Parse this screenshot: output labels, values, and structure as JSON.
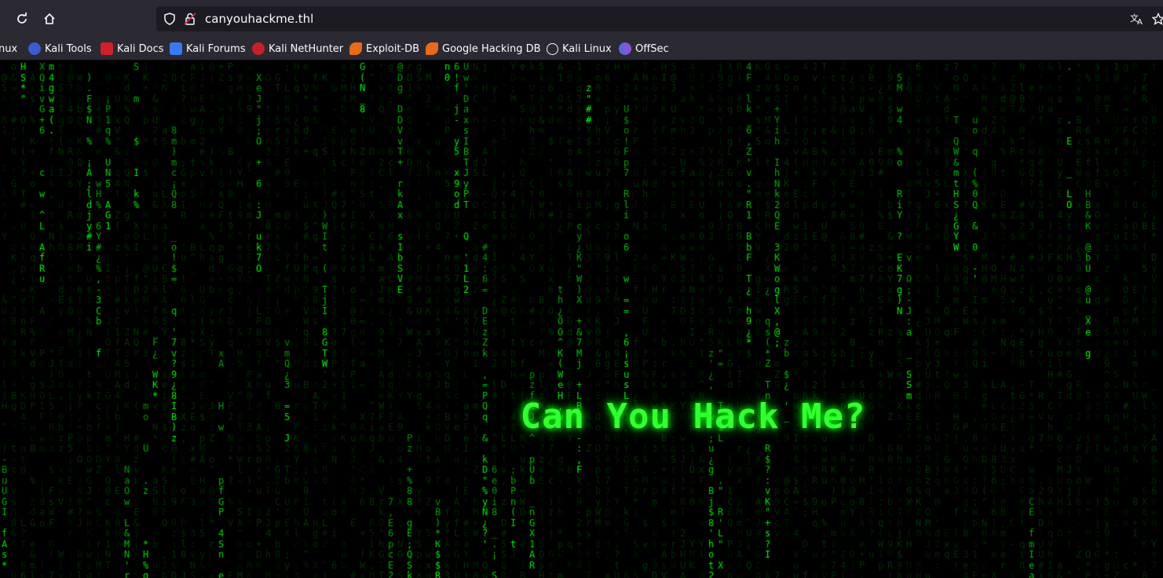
{
  "browser": {
    "url": "canyouhackme.thl",
    "bookmarks": [
      {
        "label": "nux",
        "icon": "kali-icon"
      },
      {
        "label": "Kali Tools",
        "icon": "kali-tools-icon"
      },
      {
        "label": "Kali Docs",
        "icon": "kali-docs-icon"
      },
      {
        "label": "Kali Forums",
        "icon": "kali-forums-icon"
      },
      {
        "label": "Kali NetHunter",
        "icon": "nethunter-icon"
      },
      {
        "label": "Exploit-DB",
        "icon": "exploit-db-icon"
      },
      {
        "label": "Google Hacking DB",
        "icon": "ghdb-icon"
      },
      {
        "label": "Kali Linux",
        "icon": "globe-icon"
      },
      {
        "label": "OffSec",
        "icon": "offsec-icon"
      }
    ]
  },
  "page": {
    "heading": "Can You Hack Me?"
  },
  "colors": {
    "rain": "#00ff00",
    "title": "#33ff33",
    "background": "#000000",
    "toolbar": "#2b2a33"
  }
}
